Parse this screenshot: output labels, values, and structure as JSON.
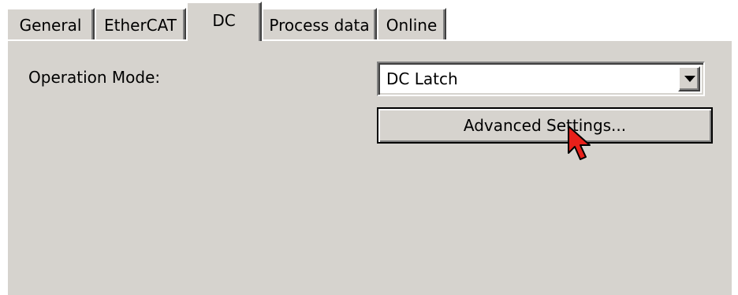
{
  "tabs": {
    "general": "General",
    "ethercat": "EtherCAT",
    "dc": "DC",
    "process_data": "Process data",
    "online": "Online",
    "active": "DC"
  },
  "form": {
    "operation_mode_label": "Operation Mode:",
    "operation_mode_value": "DC Latch",
    "advanced_settings_label": "Advanced Settings..."
  },
  "icons": {
    "dropdown_arrow": "chevron-down-icon",
    "cursor": "mouse-pointer-icon"
  },
  "colors": {
    "panel_background": "#d6d3ce",
    "cursor_fill": "#e8201a"
  }
}
